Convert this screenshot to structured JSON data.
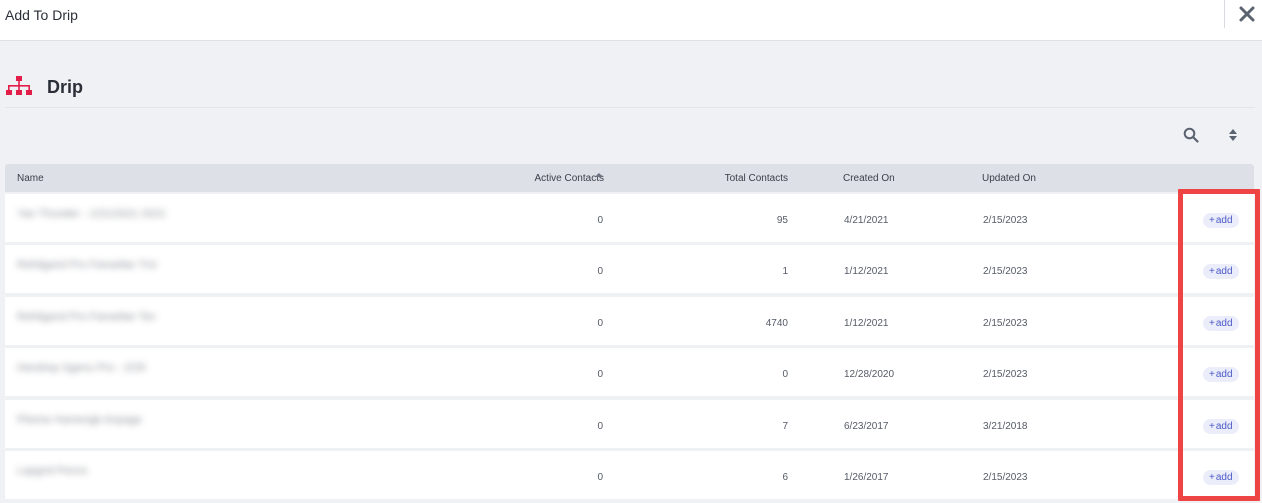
{
  "modal": {
    "title": "Add To Drip"
  },
  "section": {
    "title": "Drip",
    "accent_color": "#e11d48"
  },
  "toolbar": {
    "search_icon": "search-icon",
    "sort_icon": "sort-toggle-icon"
  },
  "table": {
    "columns": {
      "name": "Name",
      "active": "Active Contacts",
      "total": "Total Contacts",
      "created": "Created On",
      "updated": "Updated On"
    },
    "sorted_by": "Active Contacts",
    "add_label": "add",
    "rows": [
      {
        "name": "Yan Thunder - 1/21/2021 2021",
        "active": "0",
        "total": "95",
        "created": "4/21/2021",
        "updated": "2/15/2023"
      },
      {
        "name": "Rehilgand Pro Fanseltar Trsi",
        "active": "0",
        "total": "1",
        "created": "1/12/2021",
        "updated": "2/15/2023"
      },
      {
        "name": "Rehilgand Pro Fanseltar Tsn",
        "active": "0",
        "total": "4740",
        "created": "1/12/2021",
        "updated": "2/15/2023"
      },
      {
        "name": "Hendrep Sgenu Pro - 2/29",
        "active": "0",
        "total": "0",
        "created": "12/28/2020",
        "updated": "2/15/2023"
      },
      {
        "name": "Pitome Hamerigk Anpage",
        "active": "0",
        "total": "7",
        "created": "6/23/2017",
        "updated": "3/21/2018"
      },
      {
        "name": "Lapgnd Penvs",
        "active": "0",
        "total": "6",
        "created": "1/26/2017",
        "updated": "2/15/2023"
      }
    ]
  },
  "highlight_color": "#ef4444"
}
